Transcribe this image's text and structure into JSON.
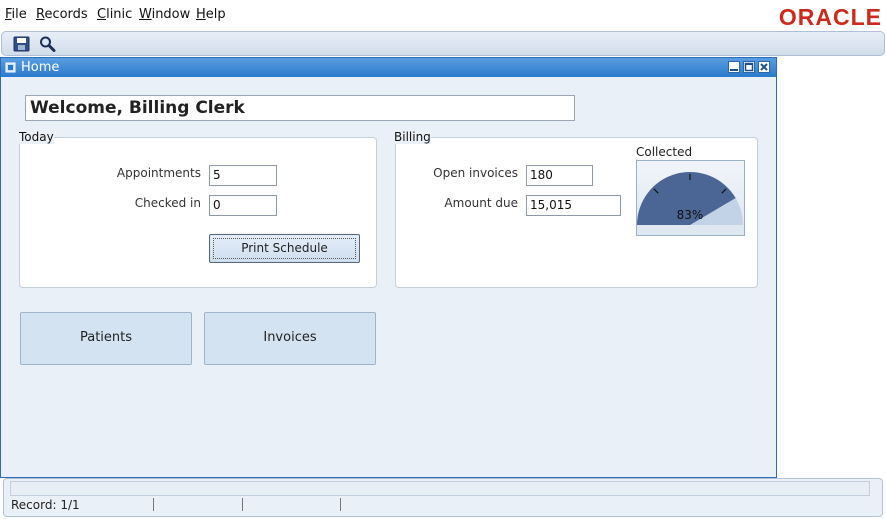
{
  "menu": {
    "file": {
      "mnemonic": "F",
      "rest": "ile"
    },
    "records": {
      "mnemonic": "R",
      "rest": "ecords"
    },
    "clinic": {
      "mnemonic": "C",
      "rest": "linic"
    },
    "window": {
      "mnemonic": "W",
      "rest": "indow"
    },
    "help": {
      "mnemonic": "H",
      "rest": "elp"
    }
  },
  "brand": {
    "logo_text": "ORACLE",
    "color": "#cc2a1c"
  },
  "toolbar": {
    "icons": [
      "save-icon",
      "search-icon"
    ]
  },
  "window": {
    "title": "Home",
    "title_bar_color": "#2a7acc"
  },
  "welcome": {
    "text": "Welcome, Billing Clerk"
  },
  "today": {
    "group_label": "Today",
    "appointments_label": "Appointments",
    "appointments_value": "5",
    "checked_in_label": "Checked in",
    "checked_in_value": "0",
    "print_button": "Print Schedule"
  },
  "billing": {
    "group_label": "Billing",
    "open_invoices_label": "Open invoices",
    "open_invoices_value": "180",
    "amount_due_label": "Amount due",
    "amount_due_value": "15,015",
    "gauge_label": "Collected",
    "gauge_value_text": "83%",
    "gauge_fraction": 0.83
  },
  "nav": {
    "patients": "Patients",
    "invoices": "Invoices"
  },
  "status": {
    "record": "Record: 1/1"
  }
}
